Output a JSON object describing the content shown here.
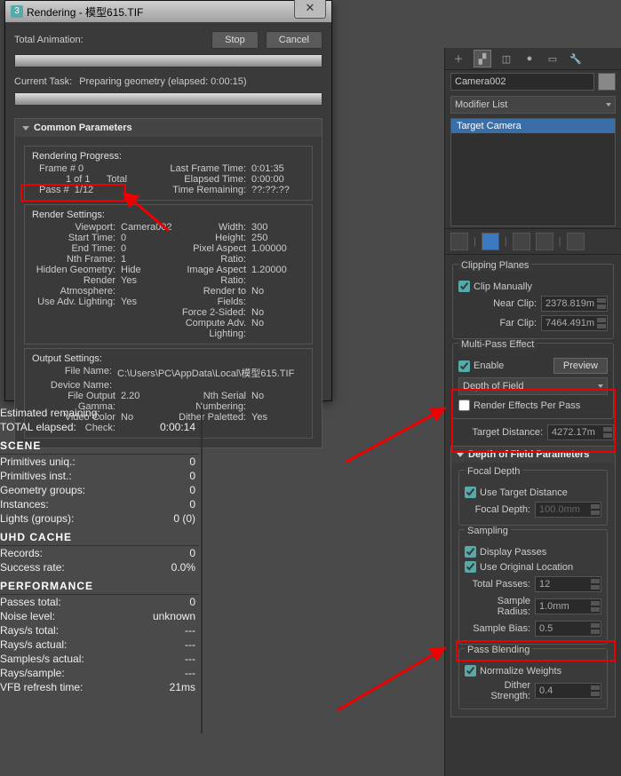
{
  "dialog": {
    "title": "Rendering - 模型615.TIF",
    "stop": "Stop",
    "cancel": "Cancel",
    "totalAnimation": "Total Animation:",
    "currentTask": "Current Task:",
    "currentTaskVal": "Preparing geometry (elapsed: 0:00:15)",
    "group": "Common Parameters",
    "renderingProgress": "Rendering Progress:",
    "frame": "Frame #",
    "frameV": "0",
    "oneof": "1 of 1",
    "total": "Total",
    "lastFrame": "Last Frame Time:",
    "lastFrameV": "0:01:35",
    "elapsed": "Elapsed Time:",
    "elapsedV": "0:00:00",
    "pass": "Pass #",
    "passV": "1/12",
    "timeRemain": "Time Remaining:",
    "timeRemainV": "??:??:??",
    "renderSettings": "Render Settings:",
    "viewport": "Viewport:",
    "viewportV": "Camera002",
    "width": "Width:",
    "widthV": "300",
    "start": "Start Time:",
    "startV": "0",
    "height": "Height:",
    "heightV": "250",
    "end": "End Time:",
    "endV": "0",
    "par": "Pixel Aspect Ratio:",
    "parV": "1.00000",
    "nth": "Nth Frame:",
    "nthV": "1",
    "iar": "Image Aspect Ratio:",
    "iarV": "1.20000",
    "hid": "Hidden Geometry:",
    "hidV": "Hide",
    "rtf": "Render to Fields:",
    "rtfV": "No",
    "atm": "Render Atmosphere:",
    "atmV": "Yes",
    "f2s": "Force 2-Sided:",
    "f2sV": "No",
    "adv": "Use Adv. Lighting:",
    "advV": "Yes",
    "cadv": "Compute Adv. Lighting:",
    "cadvV": "No",
    "output": "Output Settings:",
    "fn": "File Name:",
    "fnV": "C:\\Users\\PC\\AppData\\Local\\模型615.TIF",
    "dn": "Device Name:",
    "gamma": "File Output Gamma:",
    "gammaV": "2.20",
    "serial": "Nth Serial Numbering:",
    "serialV": "No",
    "vcc": "Video Color Check:",
    "vccV": "No",
    "dp": "Dither Paletted:",
    "dpV": "Yes"
  },
  "stats": {
    "estLabel": "Estimated remaining:",
    "totEl": "TOTAL elapsed:",
    "totElV": "0:00:14",
    "scene": "SCENE",
    "puniq": "Primitives uniq.:",
    "puniqV": "0",
    "pinst": "Primitives inst.:",
    "pinstV": "0",
    "ggrp": "Geometry groups:",
    "ggrpV": "0",
    "inst": "Instances:",
    "instV": "0",
    "lights": "Lights (groups):",
    "lightsV": "0 (0)",
    "uhd": "UHD CACHE",
    "rec": "Records:",
    "recV": "0",
    "succ": "Success rate:",
    "succV": "0.0%",
    "perf": "PERFORMANCE",
    "ptot": "Passes total:",
    "ptotV": "0",
    "noise": "Noise level:",
    "noiseV": "unknown",
    "rst": "Rays/s total:",
    "rstV": "---",
    "rsa": "Rays/s actual:",
    "rsaV": "---",
    "ssa": "Samples/s actual:",
    "ssaV": "---",
    "rsmp": "Rays/sample:",
    "rsmpV": "---",
    "vfb": "VFB refresh time:",
    "vfbV": "21ms"
  },
  "panel": {
    "camera": "Camera002",
    "modlist": "Modifier List",
    "target": "Target Camera",
    "clip": "Clipping Planes",
    "clipman": "Clip Manually",
    "near": "Near Clip:",
    "nearV": "2378.819m",
    "far": "Far Clip:",
    "farV": "7464.491m",
    "mpe": "Multi-Pass Effect",
    "enable": "Enable",
    "preview": "Preview",
    "dof": "Depth of Field",
    "repp": "Render Effects Per Pass",
    "tdist": "Target Distance:",
    "tdistV": "4272.17m",
    "dofp": "Depth of Field Parameters",
    "focal": "Focal Depth",
    "utd": "Use Target Distance",
    "fd": "Focal Depth:",
    "fdV": "100.0mm",
    "sampling": "Sampling",
    "disp": "Display Passes",
    "uol": "Use Original Location",
    "tp": "Total Passes:",
    "tpV": "12",
    "sr": "Sample Radius:",
    "srV": "1.0mm",
    "sb": "Sample Bias:",
    "sbV": "0.5",
    "pb": "Pass Blending",
    "nw": "Normalize Weights",
    "ds": "Dither Strength:",
    "dsV": "0.4"
  }
}
